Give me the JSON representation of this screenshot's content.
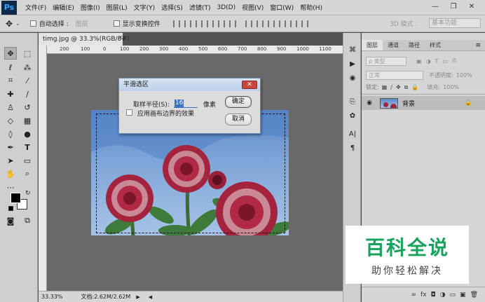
{
  "app": {
    "logo": "Ps"
  },
  "menu": [
    "文件(F)",
    "编辑(E)",
    "图像(I)",
    "图层(L)",
    "文字(Y)",
    "选择(S)",
    "滤镜(T)",
    "3D(D)",
    "视图(V)",
    "窗口(W)",
    "帮助(H)"
  ],
  "window": {
    "minimize": "—",
    "restore": "❐",
    "close": "✕"
  },
  "options": {
    "auto_select": "自动选择 :",
    "auto_select_target": "图层",
    "show_transform": "显示变换控件",
    "mode_3d": "3D 模式 :",
    "workspace": "基本功能"
  },
  "document": {
    "tab": "timg.jpg @ 33.3%(RGB/8#)",
    "tab_close": "×",
    "zoom": "33.33%",
    "doc_info": "文档:2.62M/2.62M",
    "ruler_ticks": [
      "200",
      "100",
      "0",
      "100",
      "200",
      "300",
      "400",
      "500",
      "600",
      "700",
      "800",
      "900",
      "1000",
      "1100"
    ]
  },
  "dialog": {
    "title": "平滑选区",
    "close": "✕",
    "radius_label": "取样半径(S):",
    "radius_value": "16",
    "unit": "像素",
    "apply_edge": "应用画布边界的效果",
    "ok": "确定",
    "cancel": "取消"
  },
  "layers_panel": {
    "tabs": [
      "图层",
      "通道",
      "路径",
      "样式"
    ],
    "kind_filter": "ρ 类型",
    "blend_mode": "正常",
    "opacity_label": "不透明度:",
    "opacity_value": "100%",
    "lock_label": "锁定:",
    "fill_label": "填充:",
    "fill_value": "100%",
    "layer_name": "背景",
    "bottom_icons": [
      "∞",
      "fx",
      "◘",
      "◑",
      "▭",
      "▣",
      "🗑"
    ]
  },
  "watermark": {
    "title": "百科全说",
    "subtitle": "助你轻松解决"
  },
  "colors": {
    "accent": "#3a73c5",
    "watermark": "#17a35b",
    "dialog_close": "#c9463d"
  }
}
